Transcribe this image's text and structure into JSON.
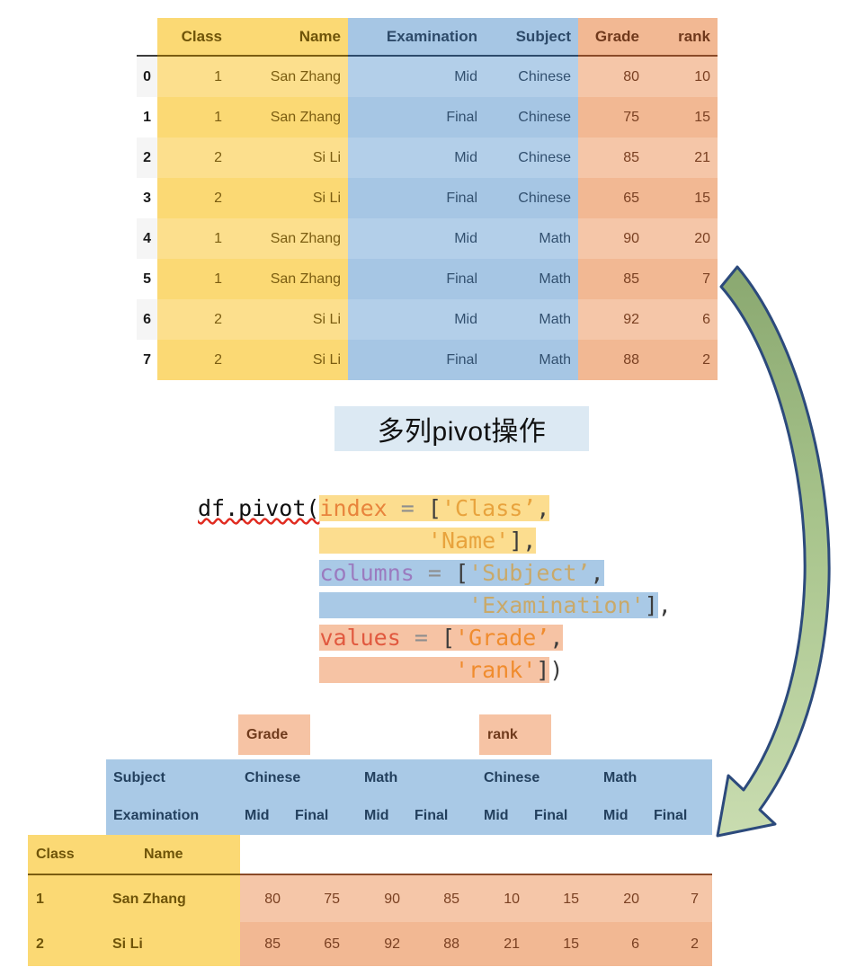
{
  "source_table": {
    "columns": [
      "Class",
      "Name",
      "Examination",
      "Subject",
      "Grade",
      "rank"
    ],
    "index_header": "",
    "rows": [
      {
        "idx": "0",
        "Class": "1",
        "Name": "San Zhang",
        "Examination": "Mid",
        "Subject": "Chinese",
        "Grade": "80",
        "rank": "10"
      },
      {
        "idx": "1",
        "Class": "1",
        "Name": "San Zhang",
        "Examination": "Final",
        "Subject": "Chinese",
        "Grade": "75",
        "rank": "15"
      },
      {
        "idx": "2",
        "Class": "2",
        "Name": "Si Li",
        "Examination": "Mid",
        "Subject": "Chinese",
        "Grade": "85",
        "rank": "21"
      },
      {
        "idx": "3",
        "Class": "2",
        "Name": "Si Li",
        "Examination": "Final",
        "Subject": "Chinese",
        "Grade": "65",
        "rank": "15"
      },
      {
        "idx": "4",
        "Class": "1",
        "Name": "San Zhang",
        "Examination": "Mid",
        "Subject": "Math",
        "Grade": "90",
        "rank": "20"
      },
      {
        "idx": "5",
        "Class": "1",
        "Name": "San Zhang",
        "Examination": "Final",
        "Subject": "Math",
        "Grade": "85",
        "rank": "7"
      },
      {
        "idx": "6",
        "Class": "2",
        "Name": "Si Li",
        "Examination": "Mid",
        "Subject": "Math",
        "Grade": "92",
        "rank": "6"
      },
      {
        "idx": "7",
        "Class": "2",
        "Name": "Si Li",
        "Examination": "Final",
        "Subject": "Math",
        "Grade": "88",
        "rank": "2"
      }
    ]
  },
  "caption": {
    "text": "多列pivot操作"
  },
  "code": {
    "full_text": "df.pivot(index = ['Class', 'Name'], columns = ['Subject', 'Examination'], values = ['Grade', 'rank'])",
    "tokens": {
      "call": "df.pivot(",
      "index_kw": "index",
      "columns_kw": "columns",
      "values_kw": "values",
      "eq": "=",
      "open_bracket": "[",
      "close_bracket": "]",
      "comma": ",",
      "close_paren": ")",
      "s_class": "'Class’",
      "s_name": "'Name'",
      "s_subject": "'Subject’",
      "s_examination": "'Examination'",
      "s_grade": "'Grade’",
      "s_rank": "'rank'"
    },
    "lines": [
      "df.pivot(index = ['Class’,",
      "                 'Name'],",
      "         columns = ['Subject’,",
      "                    'Examination'],",
      "         values = ['Grade’,",
      "                   'rank'])"
    ]
  },
  "result_table": {
    "value_groups": [
      "Grade",
      "rank"
    ],
    "row_header_labels": [
      "Subject",
      "Examination"
    ],
    "index_labels": [
      "Class",
      "Name"
    ],
    "subject_row": [
      "Chinese",
      "Math",
      "Chinese",
      "Math"
    ],
    "examination_row": [
      "Mid",
      "Final",
      "Mid",
      "Final",
      "Mid",
      "Final",
      "Mid",
      "Final"
    ],
    "rows": [
      {
        "Class": "1",
        "Name": "San Zhang",
        "values": [
          "80",
          "75",
          "90",
          "85",
          "10",
          "15",
          "20",
          "7"
        ]
      },
      {
        "Class": "2",
        "Name": "Si Li",
        "values": [
          "85",
          "65",
          "92",
          "88",
          "21",
          "15",
          "6",
          "2"
        ]
      }
    ]
  },
  "arrow": {
    "name": "curved-transform-arrow",
    "direction": "down-left",
    "fill_top": "#8aa870",
    "fill_bottom": "#c2d8a5",
    "stroke": "#2c4a7c"
  },
  "colors": {
    "index_yellow": "#fbd974",
    "columns_blue": "#a6c6e4",
    "values_orange": "#f2b893",
    "caption_bg": "#dce9f3"
  }
}
